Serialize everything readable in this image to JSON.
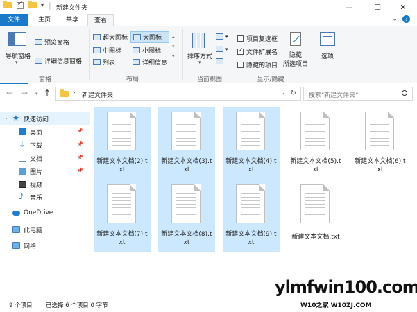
{
  "window": {
    "title": "新建文件夹",
    "minimize_icon": "—",
    "maximize_icon": "☐",
    "close_icon": "✕"
  },
  "tabs": [
    {
      "label": "文件"
    },
    {
      "label": "主页"
    },
    {
      "label": "共享"
    },
    {
      "label": "查看"
    }
  ],
  "ribbon": {
    "pane": {
      "nav_pane": "导航窗格",
      "preview_pane": "预览窗格",
      "details_pane": "详细信息窗格",
      "group": "窗格"
    },
    "layout": {
      "xl_icons": "超大图标",
      "large_icons": "大图标",
      "medium_icons": "中图标",
      "small_icons": "小图标",
      "list": "列表",
      "details": "详细信息",
      "group": "布局"
    },
    "current_view": {
      "sort_by": "排序方式",
      "group": "当前视图"
    },
    "show_hide": {
      "item_checkboxes": "项目复选框",
      "file_extensions": "文件扩展名",
      "hidden_items": "隐藏的项目",
      "hide_selected_line1": "隐藏",
      "hide_selected_line2": "所选项目",
      "group": "显示/隐藏"
    },
    "options": {
      "label": "选项"
    }
  },
  "address": {
    "path": "新建文件夹",
    "search_placeholder": "搜索\"新建文件夹\""
  },
  "sidebar": {
    "items": [
      {
        "label": "快速访问"
      },
      {
        "label": "桌面"
      },
      {
        "label": "下载"
      },
      {
        "label": "文档"
      },
      {
        "label": "图片"
      },
      {
        "label": "视频"
      },
      {
        "label": "音乐"
      },
      {
        "label": "OneDrive"
      },
      {
        "label": "此电脑"
      },
      {
        "label": "网络"
      }
    ]
  },
  "files": [
    {
      "name": "新建文本文档(2).txt"
    },
    {
      "name": "新建文本文档(3).txt"
    },
    {
      "name": "新建文本文档(4).txt"
    },
    {
      "name": "新建文本文档(5).txt"
    },
    {
      "name": "新建文本文档(6).txt"
    },
    {
      "name": "新建文本文档(7).txt"
    },
    {
      "name": "新建文本文档(8).txt"
    },
    {
      "name": "新建文本文档(9).txt"
    },
    {
      "name": "新建文本文档.txt"
    }
  ],
  "status": {
    "count": "9 个项目",
    "selected": "已选择 6 个项目 0 字节"
  },
  "watermark": {
    "line1": "ylmfwin100.com",
    "line2": "W10之家 W10ZJ.COM"
  },
  "colors": {
    "file_tab": "#1979ca",
    "selection": "#cce8ff",
    "folder": "#f5c542"
  }
}
